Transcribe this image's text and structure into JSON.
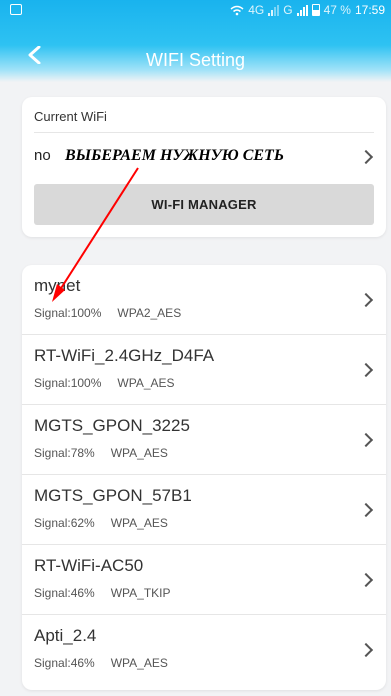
{
  "status_bar": {
    "signal_1": "4G",
    "signal_2": "G",
    "battery": "47 %",
    "time": "17:59"
  },
  "header": {
    "title": "WIFI Setting",
    "back_icon": "chevron-left-icon"
  },
  "current_wifi": {
    "label": "Current WiFi",
    "value": "no",
    "button_label": "WI-FI MANAGER"
  },
  "annotation": {
    "text": "ВЫБЕРАЕМ НУЖНУЮ СЕТЬ",
    "color": "#ff0000"
  },
  "networks": [
    {
      "name": "mynet",
      "signal": "Signal:100%",
      "security": "WPA2_AES"
    },
    {
      "name": "RT-WiFi_2.4GHz_D4FA",
      "signal": "Signal:100%",
      "security": "WPA_AES"
    },
    {
      "name": "MGTS_GPON_3225",
      "signal": "Signal:78%",
      "security": "WPA_AES"
    },
    {
      "name": "MGTS_GPON_57B1",
      "signal": "Signal:62%",
      "security": "WPA_AES"
    },
    {
      "name": "RT-WiFi-AC50",
      "signal": "Signal:46%",
      "security": "WPA_TKIP"
    },
    {
      "name": "Apti_2.4",
      "signal": "Signal:46%",
      "security": "WPA_AES"
    }
  ],
  "colors": {
    "header": "#19b3ee",
    "background": "#f2f3f5",
    "button": "#d9d9d9"
  }
}
